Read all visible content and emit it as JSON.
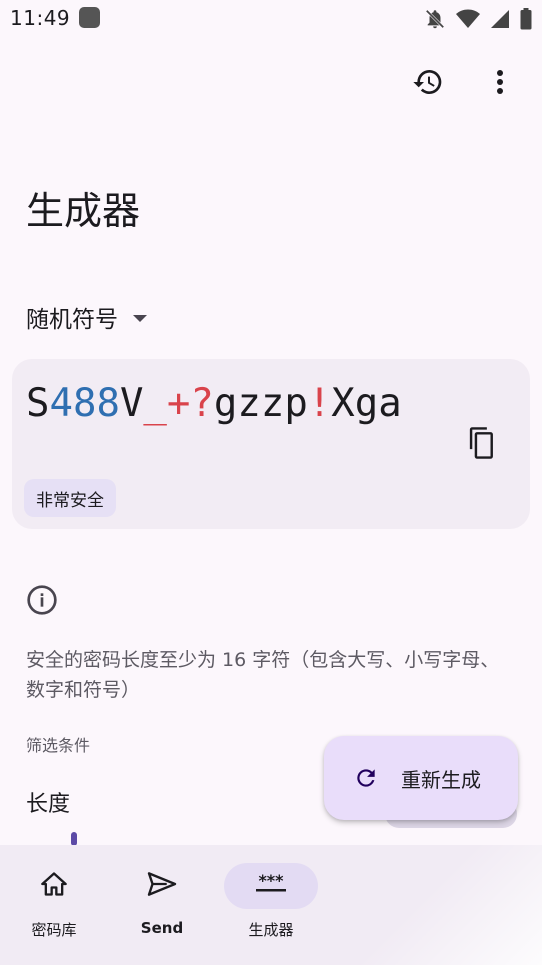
{
  "status_bar": {
    "time": "11:49"
  },
  "header": {
    "title": "生成器"
  },
  "type_dropdown": {
    "selected": "随机符号"
  },
  "password": {
    "segments": [
      {
        "text": "S",
        "kind": "letter"
      },
      {
        "text": "488",
        "kind": "number"
      },
      {
        "text": "V",
        "kind": "letter"
      },
      {
        "text": "_+?",
        "kind": "symbol"
      },
      {
        "text": "gzzp",
        "kind": "letter"
      },
      {
        "text": "!",
        "kind": "symbol"
      },
      {
        "text": "Xga",
        "kind": "letter"
      }
    ],
    "strength": "非常安全"
  },
  "tip": {
    "text": "安全的密码长度至少为 16 字符（包含大写、小写字母、数字和符号）"
  },
  "options": {
    "filters_label": "筛选条件",
    "length_label": "长度"
  },
  "fab": {
    "label": "重新生成"
  },
  "bottom_nav": {
    "items": [
      {
        "label": "密码库",
        "icon": "home-icon"
      },
      {
        "label": "Send",
        "icon": "send-icon"
      },
      {
        "label": "生成器",
        "icon": "password-icon",
        "active": true
      }
    ]
  },
  "colors": {
    "number": "#2f6fb1",
    "symbol": "#d9434b",
    "accent": "#5c4aa6"
  }
}
